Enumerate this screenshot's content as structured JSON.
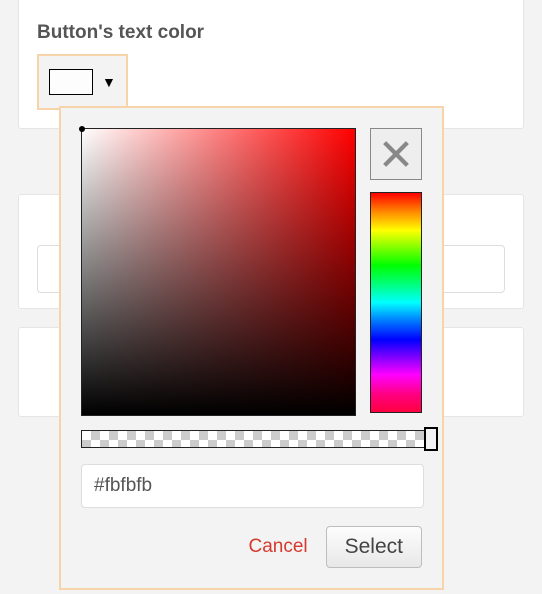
{
  "field": {
    "label": "Button's text color"
  },
  "trigger": {
    "swatch_color": "#fdfdfd",
    "caret": "▼"
  },
  "picker": {
    "hex_value": "#fbfbfb",
    "cancel_label": "Cancel",
    "select_label": "Select",
    "close_icon_name": "close-x"
  }
}
